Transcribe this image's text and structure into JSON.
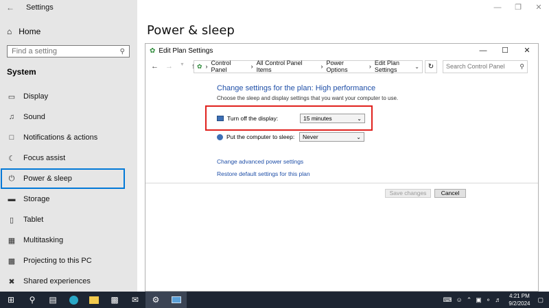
{
  "settings": {
    "app_title": "Settings",
    "home_label": "Home",
    "search_placeholder": "Find a setting",
    "section_label": "System",
    "page_heading": "Power & sleep",
    "nav_items": [
      {
        "label": "Display",
        "icon": "display-icon"
      },
      {
        "label": "Sound",
        "icon": "speaker-icon"
      },
      {
        "label": "Notifications & actions",
        "icon": "notification-icon"
      },
      {
        "label": "Focus assist",
        "icon": "moon-icon"
      },
      {
        "label": "Power & sleep",
        "icon": "power-icon",
        "active": true
      },
      {
        "label": "Storage",
        "icon": "storage-icon"
      },
      {
        "label": "Tablet",
        "icon": "tablet-icon"
      },
      {
        "label": "Multitasking",
        "icon": "multitasking-icon"
      },
      {
        "label": "Projecting to this PC",
        "icon": "projector-icon"
      },
      {
        "label": "Shared experiences",
        "icon": "share-icon"
      }
    ]
  },
  "edit_window": {
    "title": "Edit Plan Settings",
    "breadcrumb": [
      "Control Panel",
      "All Control Panel Items",
      "Power Options",
      "Edit Plan Settings"
    ],
    "search_placeholder": "Search Control Panel",
    "heading": "Change settings for the plan: High performance",
    "subheading": "Choose the sleep and display settings that you want your computer to use.",
    "display_label": "Turn off the display:",
    "display_value": "15 minutes",
    "sleep_label": "Put the computer to sleep:",
    "sleep_value": "Never",
    "link_advanced": "Change advanced power settings",
    "link_restore": "Restore default settings for this plan",
    "save_label": "Save changes",
    "cancel_label": "Cancel"
  },
  "taskbar": {
    "time": "4:21 PM",
    "date": "9/2/2024"
  },
  "colors": {
    "accent": "#0078d7",
    "link": "#1e4ea7",
    "highlight": "#e0201c"
  }
}
